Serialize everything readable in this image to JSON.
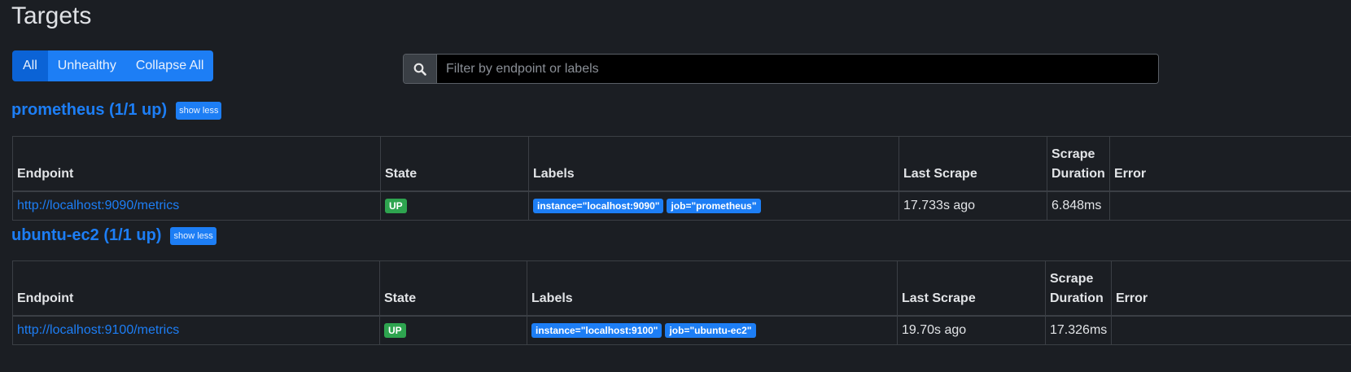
{
  "page": {
    "title": "Targets"
  },
  "filters": {
    "all": "All",
    "unhealthy": "Unhealthy",
    "collapse_all": "Collapse All"
  },
  "search": {
    "placeholder": "Filter by endpoint or labels",
    "value": ""
  },
  "columns": {
    "endpoint": "Endpoint",
    "state": "State",
    "labels": "Labels",
    "last_scrape": "Last Scrape",
    "scrape_duration_1": "Scrape",
    "scrape_duration_2": "Duration",
    "error": "Error"
  },
  "pools": [
    {
      "name": "prometheus (1/1 up)",
      "toggle": "show less",
      "rows": [
        {
          "endpoint": "http://localhost:9090/metrics",
          "state": "UP",
          "labels": [
            "instance=\"localhost:9090\"",
            "job=\"prometheus\""
          ],
          "last_scrape": "17.733s ago",
          "scrape_duration": "6.848ms",
          "error": ""
        }
      ]
    },
    {
      "name": "ubuntu-ec2 (1/1 up)",
      "toggle": "show less",
      "rows": [
        {
          "endpoint": "http://localhost:9100/metrics",
          "state": "UP",
          "labels": [
            "instance=\"localhost:9100\"",
            "job=\"ubuntu-ec2\""
          ],
          "last_scrape": "19.70s ago",
          "scrape_duration": "17.326ms",
          "error": ""
        }
      ]
    }
  ],
  "colors": {
    "background": "#1b1e23",
    "accent": "#1d7ef5",
    "accent_active": "#0b63d6",
    "up": "#2ea44f"
  },
  "icons": {
    "search": "search-icon"
  }
}
